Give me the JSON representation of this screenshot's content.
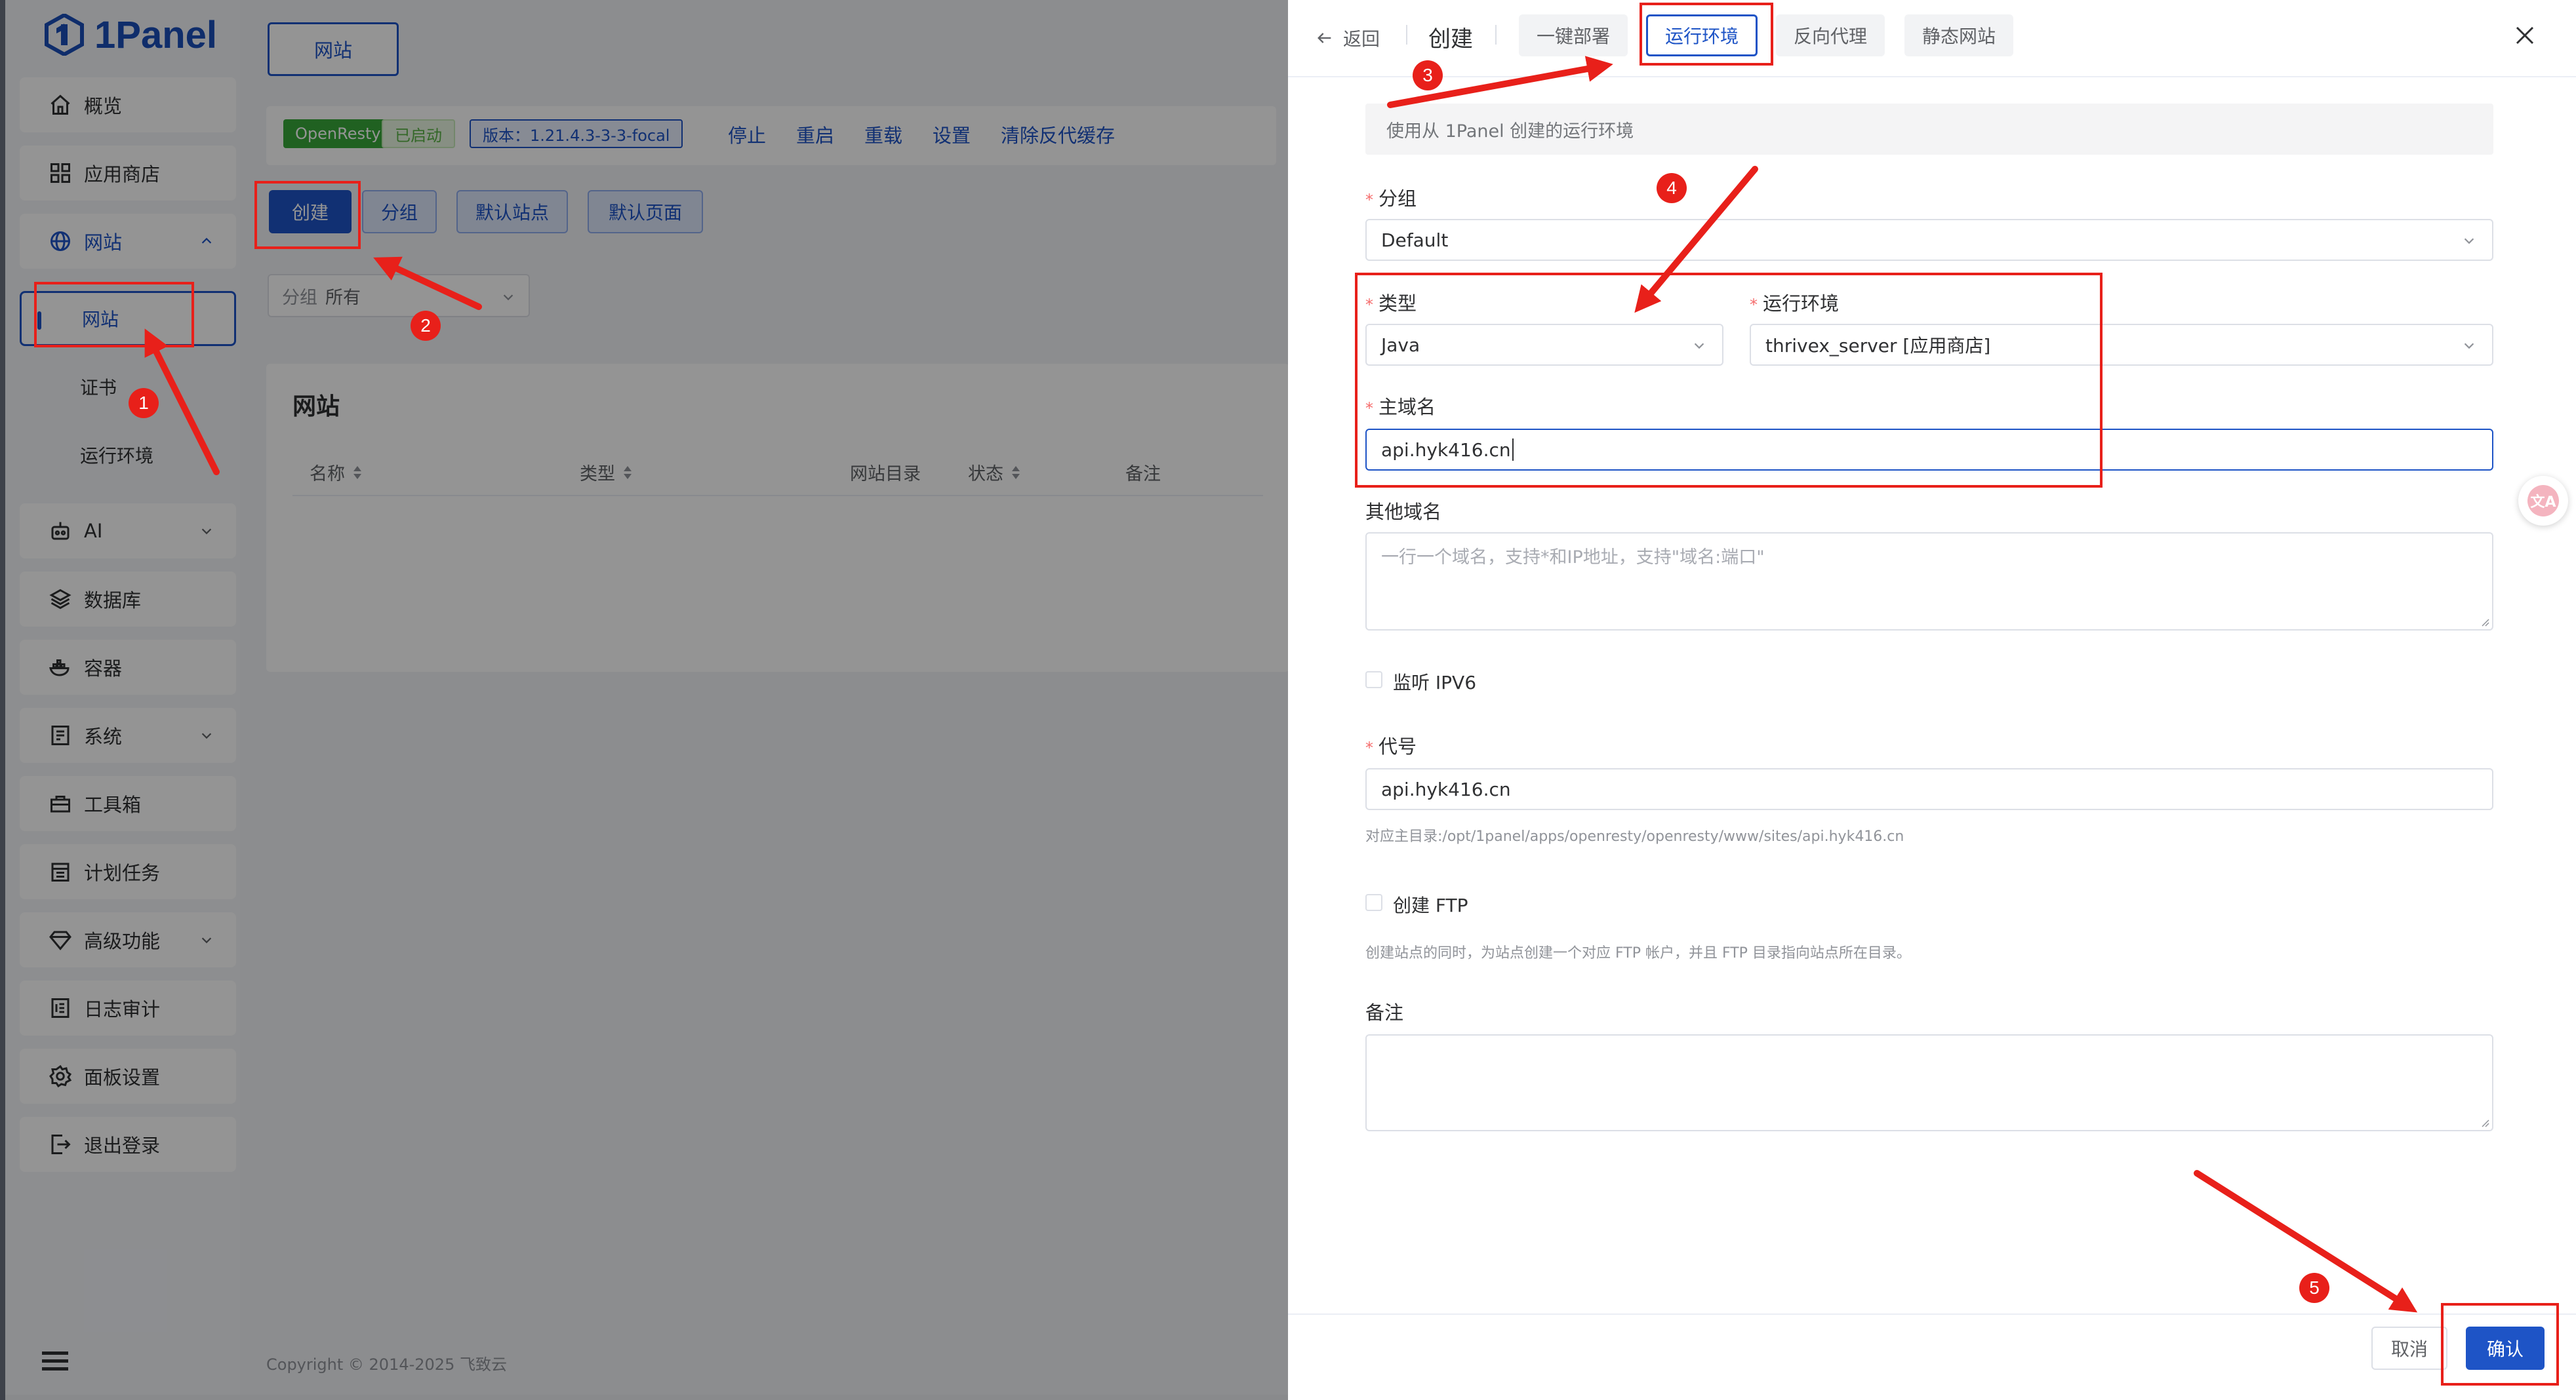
{
  "brand": {
    "name": "1Panel"
  },
  "sidebar": {
    "items": [
      {
        "label": "概览",
        "icon": "home-icon"
      },
      {
        "label": "应用商店",
        "icon": "apps-grid-icon"
      },
      {
        "label": "网站",
        "icon": "globe-icon",
        "expanded": true,
        "children": [
          {
            "label": "网站",
            "active": true
          },
          {
            "label": "证书"
          },
          {
            "label": "运行环境"
          }
        ]
      },
      {
        "label": "AI",
        "icon": "robot-icon",
        "has_children": true
      },
      {
        "label": "数据库",
        "icon": "database-icon"
      },
      {
        "label": "容器",
        "icon": "container-icon"
      },
      {
        "label": "系统",
        "icon": "system-icon",
        "has_children": true
      },
      {
        "label": "工具箱",
        "icon": "toolbox-icon"
      },
      {
        "label": "计划任务",
        "icon": "calendar-icon"
      },
      {
        "label": "高级功能",
        "icon": "diamond-icon",
        "has_children": true
      },
      {
        "label": "日志审计",
        "icon": "log-icon"
      },
      {
        "label": "面板设置",
        "icon": "gear-icon"
      },
      {
        "label": "退出登录",
        "icon": "logout-icon"
      }
    ]
  },
  "main": {
    "top_tab": "网站",
    "status": {
      "app": "OpenResty",
      "state": "已启动",
      "version": "版本：1.21.4.3-3-3-focal",
      "actions": [
        "停止",
        "重启",
        "重载",
        "设置",
        "清除反代缓存"
      ]
    },
    "buttons": {
      "create": "创建",
      "group": "分组",
      "default_site": "默认站点",
      "default_page": "默认页面"
    },
    "group_filter": {
      "prefix": "分组",
      "value": "所有"
    },
    "panel_title": "网站",
    "table_headers": [
      "名称",
      "类型",
      "网站目录",
      "状态",
      "备注"
    ],
    "copyright": "Copyright © 2014-2025 飞致云"
  },
  "drawer": {
    "back": "返回",
    "title": "创建",
    "tabs": [
      {
        "label": "一键部署",
        "active": false
      },
      {
        "label": "运行环境",
        "active": true
      },
      {
        "label": "反向代理",
        "active": false
      },
      {
        "label": "静态网站",
        "active": false
      }
    ],
    "note": "使用从 1Panel 创建的运行环境",
    "form": {
      "group": {
        "label": "分组",
        "value": "Default"
      },
      "type": {
        "label": "类型",
        "value": "Java"
      },
      "runtime": {
        "label": "运行环境",
        "value": "thrivex_server [应用商店]"
      },
      "primary_domain": {
        "label": "主域名",
        "value": "api.hyk416.cn"
      },
      "other_domains": {
        "label": "其他域名",
        "placeholder": "一行一个域名，支持*和IP地址，支持\"域名:端口\""
      },
      "ipv6": {
        "label": "监听 IPV6",
        "checked": false
      },
      "alias": {
        "label": "代号",
        "value": "api.hyk416.cn",
        "hint": "对应主目录:/opt/1panel/apps/openresty/openresty/www/sites/api.hyk416.cn"
      },
      "ftp": {
        "label": "创建 FTP",
        "checked": false,
        "hint": "创建站点的同时，为站点创建一个对应 FTP 帐户，并且 FTP 目录指向站点所在目录。"
      },
      "remark": {
        "label": "备注",
        "value": ""
      }
    },
    "footer": {
      "cancel": "取消",
      "confirm": "确认"
    },
    "translate_fab": "文A"
  },
  "annotations": {
    "color": "#e8201a",
    "steps": [
      "1",
      "2",
      "3",
      "4",
      "5"
    ]
  },
  "colors": {
    "primary": "#1e54c6",
    "success": "#38a83a",
    "danger": "#f56c6c"
  }
}
